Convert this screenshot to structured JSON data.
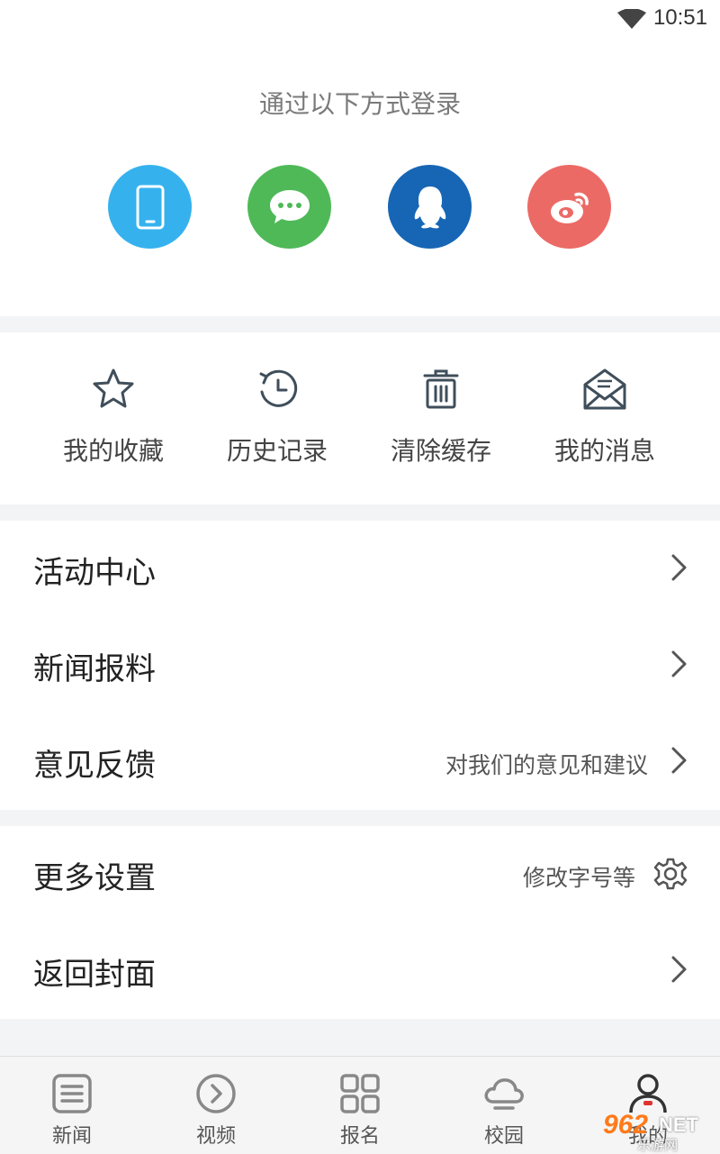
{
  "status_bar": {
    "time": "10:51"
  },
  "login": {
    "title": "通过以下方式登录",
    "methods": [
      {
        "name": "phone",
        "icon": "phone-icon",
        "color": "#35b2ee"
      },
      {
        "name": "wechat",
        "icon": "wechat-icon",
        "color": "#4fb958"
      },
      {
        "name": "qq",
        "icon": "qq-icon",
        "color": "#1666b5"
      },
      {
        "name": "weibo",
        "icon": "weibo-icon",
        "color": "#ec6a66"
      }
    ]
  },
  "quick_actions": [
    {
      "label": "我的收藏",
      "icon": "star-icon"
    },
    {
      "label": "历史记录",
      "icon": "history-icon"
    },
    {
      "label": "清除缓存",
      "icon": "trash-icon"
    },
    {
      "label": "我的消息",
      "icon": "mail-icon"
    }
  ],
  "menu": {
    "activity": {
      "label": "活动中心"
    },
    "news_tip": {
      "label": "新闻报料"
    },
    "feedback": {
      "label": "意见反馈",
      "hint": "对我们的意见和建议"
    },
    "settings": {
      "label": "更多设置",
      "hint": "修改字号等"
    },
    "cover": {
      "label": "返回封面"
    }
  },
  "bottom_nav": [
    {
      "label": "新闻",
      "icon": "news-icon"
    },
    {
      "label": "视频",
      "icon": "video-icon"
    },
    {
      "label": "报名",
      "icon": "grid-icon"
    },
    {
      "label": "校园",
      "icon": "cloud-icon"
    },
    {
      "label": "我的",
      "icon": "user-icon"
    }
  ],
  "watermark": {
    "number": "962",
    "net": "NET",
    "sub": "乐游网"
  },
  "colors": {
    "accent_red": "#e0322f",
    "icon_dark": "#3f4e5a"
  }
}
